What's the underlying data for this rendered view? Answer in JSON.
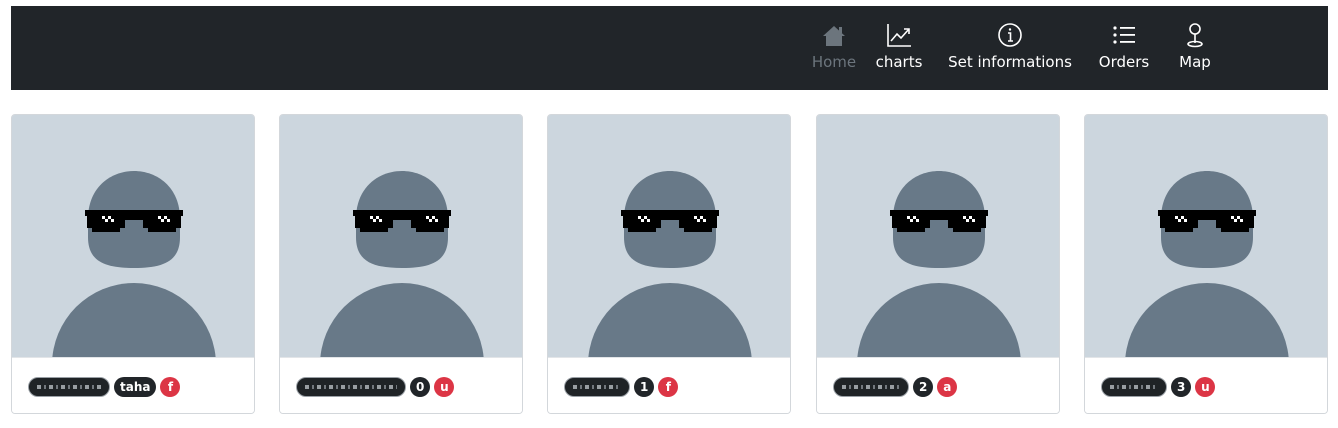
{
  "nav": {
    "items": [
      {
        "label": "Home",
        "icon": "house-icon",
        "active": false
      },
      {
        "label": "charts",
        "icon": "line-chart-icon"
      },
      {
        "label": "Set informations",
        "icon": "info-circle-icon"
      },
      {
        "label": "Orders",
        "icon": "list-icon"
      },
      {
        "label": "Map",
        "icon": "pin-icon"
      }
    ]
  },
  "cards": [
    {
      "id_badge": "taha",
      "type_badge": "f"
    },
    {
      "id_badge": "0",
      "type_badge": "u"
    },
    {
      "id_badge": "1",
      "type_badge": "f"
    },
    {
      "id_badge": "2",
      "type_badge": "a"
    },
    {
      "id_badge": "3",
      "type_badge": "u"
    }
  ],
  "colors": {
    "navbar": "#212529",
    "avatar_bg": "#ccd6de",
    "avatar_figure": "#687988",
    "badge_dark": "#212529",
    "badge_red": "#dc3545"
  }
}
